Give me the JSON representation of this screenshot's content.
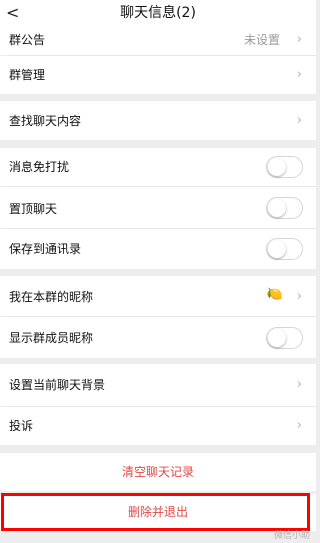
{
  "header": {
    "back_glyph": "<",
    "title": "聊天信息(2)"
  },
  "group1": [
    {
      "label": "群公告",
      "value": "未设置",
      "chevron": "›"
    },
    {
      "label": "群管理",
      "value": "",
      "chevron": "›"
    }
  ],
  "group2": [
    {
      "label": "查找聊天内容",
      "chevron": "›"
    }
  ],
  "toggles": [
    {
      "label": "消息免打扰",
      "on": false
    },
    {
      "label": "置顶聊天",
      "on": false
    },
    {
      "label": "保存到通讯录",
      "on": false
    }
  ],
  "nickname": {
    "label": "我在本群的昵称",
    "value_icon": "lemon-icon",
    "value_emoji": "🍋",
    "chevron": "›"
  },
  "show_nickname": {
    "label": "显示群成员昵称",
    "on": false
  },
  "group5": [
    {
      "label": "设置当前聊天背景",
      "chevron": "›"
    },
    {
      "label": "投诉",
      "chevron": "›"
    }
  ],
  "actions": {
    "clear": "清空聊天记录",
    "delete_exit": "删除并退出"
  },
  "watermark": "微信小助",
  "colors": {
    "danger": "#e04848",
    "highlight": "#ff0000",
    "background": "#ededed"
  }
}
